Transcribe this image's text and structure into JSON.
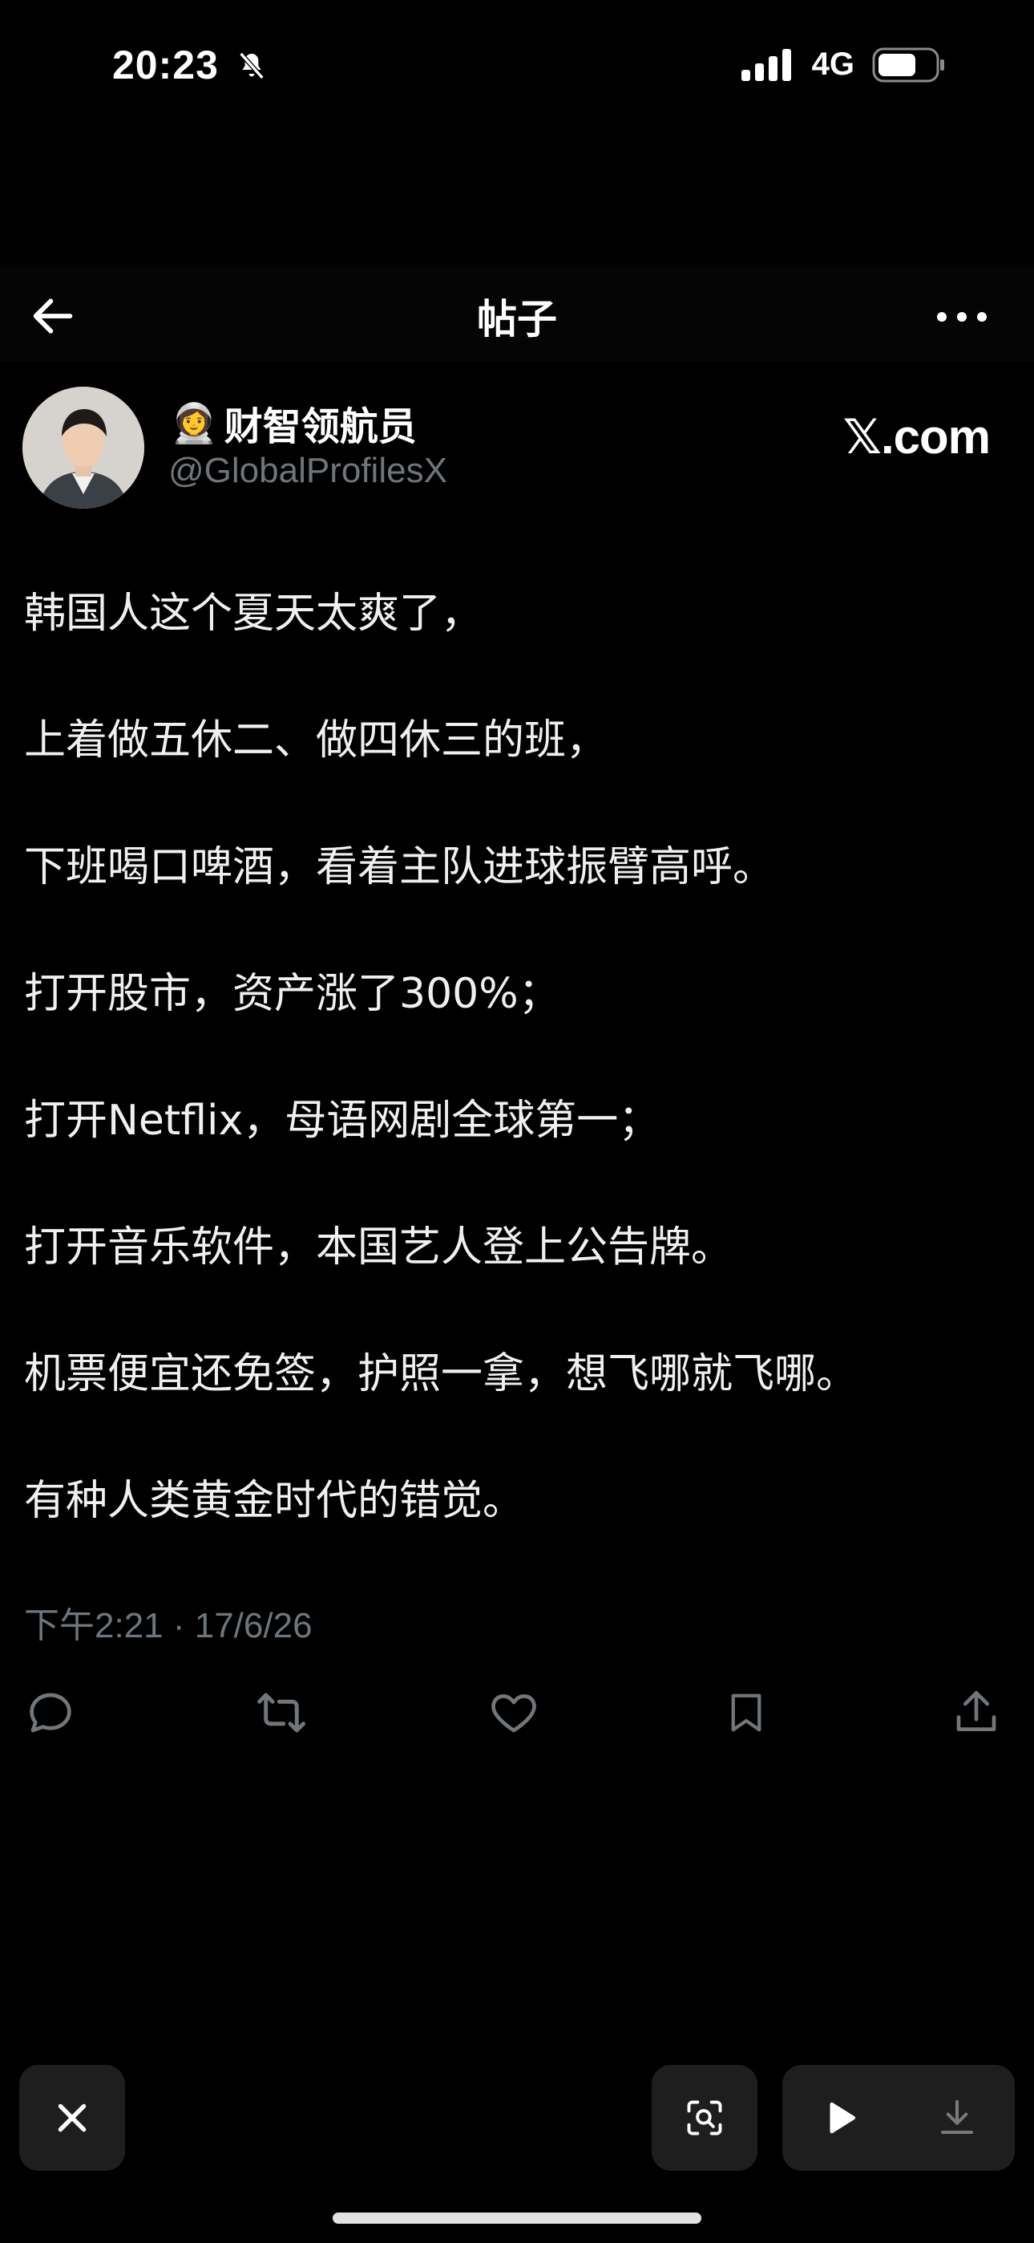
{
  "status_bar": {
    "time": "20:23",
    "network": "4G"
  },
  "nav": {
    "title": "帖子"
  },
  "author": {
    "emoji": "👩‍🚀",
    "name": "财智领航员",
    "handle": "@GlobalProfilesX",
    "brand": "𝕏.com"
  },
  "post": {
    "lines": [
      "韩国人这个夏天太爽了，",
      "上着做五休二、做四休三的班，",
      "下班喝口啤酒，看着主队进球振臂高呼。",
      "打开股市，资产涨了300%；",
      "打开Netflix，母语网剧全球第一；",
      "打开音乐软件，本国艺人登上公告牌。",
      "机票便宜还免签，护照一拿，想飞哪就飞哪。",
      "有种人类黄金时代的错觉。"
    ],
    "timestamp": "下午2:21 · 17/6/26"
  },
  "icons": {
    "back": "arrow-left-icon",
    "more": "more-horizontal-icon",
    "reply": "reply-icon",
    "repost": "repost-icon",
    "like": "heart-icon",
    "bookmark": "bookmark-icon",
    "share": "share-icon",
    "close": "close-icon",
    "scan": "scan-icon",
    "play": "play-icon",
    "download": "download-icon"
  },
  "colors": {
    "background": "#000000",
    "text": "#e7e9ea",
    "muted": "#6e767d",
    "button": "#1e1e1e"
  }
}
